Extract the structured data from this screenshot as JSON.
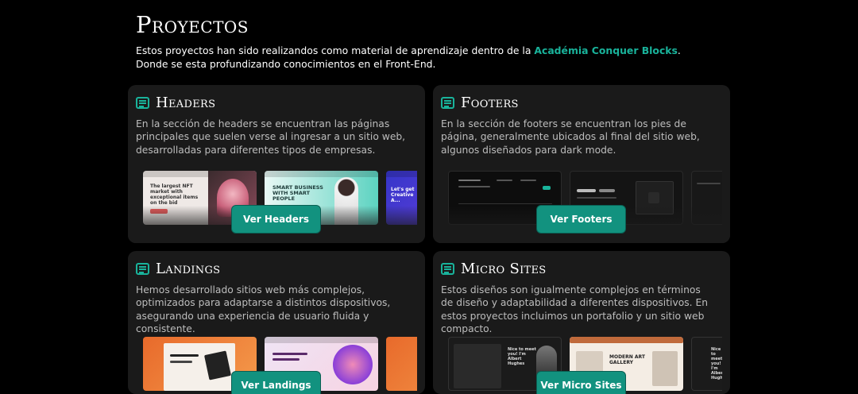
{
  "page": {
    "title": "Proyectos",
    "intro_before": "Estos proyectos han sido realizandos como material de aprendizaje dentro de la ",
    "intro_highlight": "Académia Conquer Blocks",
    "intro_after": ". Donde se esta profundizando conocimientos en el Front-End."
  },
  "colors": {
    "accent": "#19b39b",
    "button": "#12927f",
    "card": "#1a1a1a",
    "background": "#000000"
  },
  "cards": [
    {
      "title": "Headers",
      "icon": "document-list-icon",
      "description": "En la sección de headers se encuentran las páginas principales que suelen verse al ingresar a un sitio web, desarrolladas para diferentes tipos de empresas.",
      "button": "Ver Headers",
      "thumbs": [
        {
          "headline": "The largest NFT market with exceptional items on the bid"
        },
        {
          "headline": "SMART BUSINESS WITH SMART PEOPLE"
        },
        {
          "headline": "Let's get Creative A..."
        }
      ]
    },
    {
      "title": "Footers",
      "icon": "document-list-icon",
      "description": "En la sección de footers se encuentran los pies de página, generalmente ubicados al final del sitio web, algunos diseñados para dark mode.",
      "button": "Ver Footers",
      "thumbs": []
    },
    {
      "title": "Landings",
      "icon": "document-list-icon",
      "description": "Hemos desarrollado sitios web más complejos, optimizados para adaptarse a distintos dispositivos, asegurando una experiencia de usuario fluida y consistente.",
      "button": "Ver Landings",
      "thumbs": []
    },
    {
      "title": "Micro Sites",
      "icon": "document-list-icon",
      "description": "Estos diseños son igualmente complejos en términos de diseño y adaptabilidad a diferentes dispositivos. En estos proyectos incluimos un portafolio y un sitio web compacto.",
      "button": "Ver Micro Sites",
      "thumbs": [
        {
          "headline": "Nice to meet you! I'm Albert Hughes"
        },
        {
          "headline": "MODERN ART GALLERY"
        },
        {
          "headline": "Nice to meet you! I'm Albert Hughes"
        }
      ]
    }
  ]
}
